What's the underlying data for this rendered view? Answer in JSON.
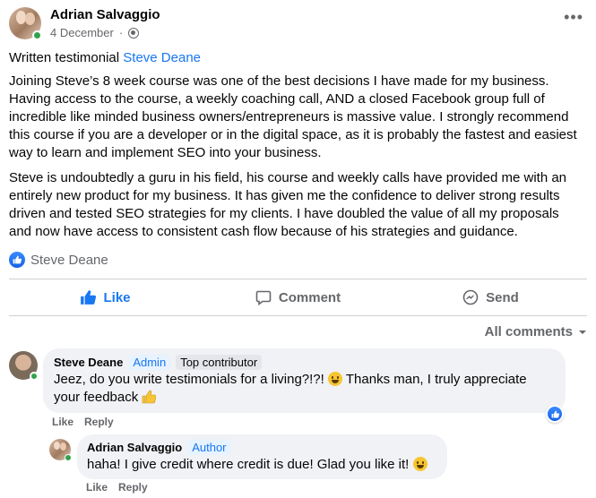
{
  "post": {
    "author": "Adrian Salvaggio",
    "date": "4 December",
    "date_separator": "·",
    "privacy_icon": "globe-icon",
    "more_icon": "ellipsis-icon",
    "title_prefix": "Written testimonial",
    "title_tag": "Steve Deane",
    "paragraph_1": "Joining Steve’s 8 week course was one of the best decisions I have made for my business. Having access to the course, a weekly coaching call, AND a closed Facebook group full of incredible like minded business owners/entrepreneurs is massive value. I strongly recommend this course if you are a developer or in the digital space, as it is probably the fastest and easiest way to learn and implement SEO into your business.",
    "paragraph_2": "Steve is undoubtedly a guru in his field, his course and weekly calls have provided me with an entirely new product for my business. It has given me the confidence to deliver strong results driven and tested SEO strategies for my clients. I have doubled the value of all my proposals and now have access to consistent cash flow because of his strategies and guidance."
  },
  "reactions": {
    "icon": "like-icon",
    "names": "Steve Deane"
  },
  "actions": {
    "like": "Like",
    "comment": "Comment",
    "send": "Send"
  },
  "comments_filter": {
    "label": "All comments",
    "icon": "caret-down-icon"
  },
  "comments": [
    {
      "author": "Steve Deane",
      "badge_admin": "Admin",
      "badge_top": "Top contributor",
      "text_1": "Jeez, do you write testimonials for a living?!?!",
      "text_2": "Thanks man, I truly appreciate your feedback",
      "like": "Like",
      "reply": "Reply"
    },
    {
      "author": "Adrian Salvaggio",
      "badge_author": "Author",
      "text": "haha! I give credit where credit is due! Glad you like it!",
      "like": "Like",
      "reply": "Reply"
    }
  ],
  "colors": {
    "accent": "#1877f2",
    "muted": "#65676b",
    "bubble": "#f0f2f5",
    "online": "#31a24c"
  }
}
